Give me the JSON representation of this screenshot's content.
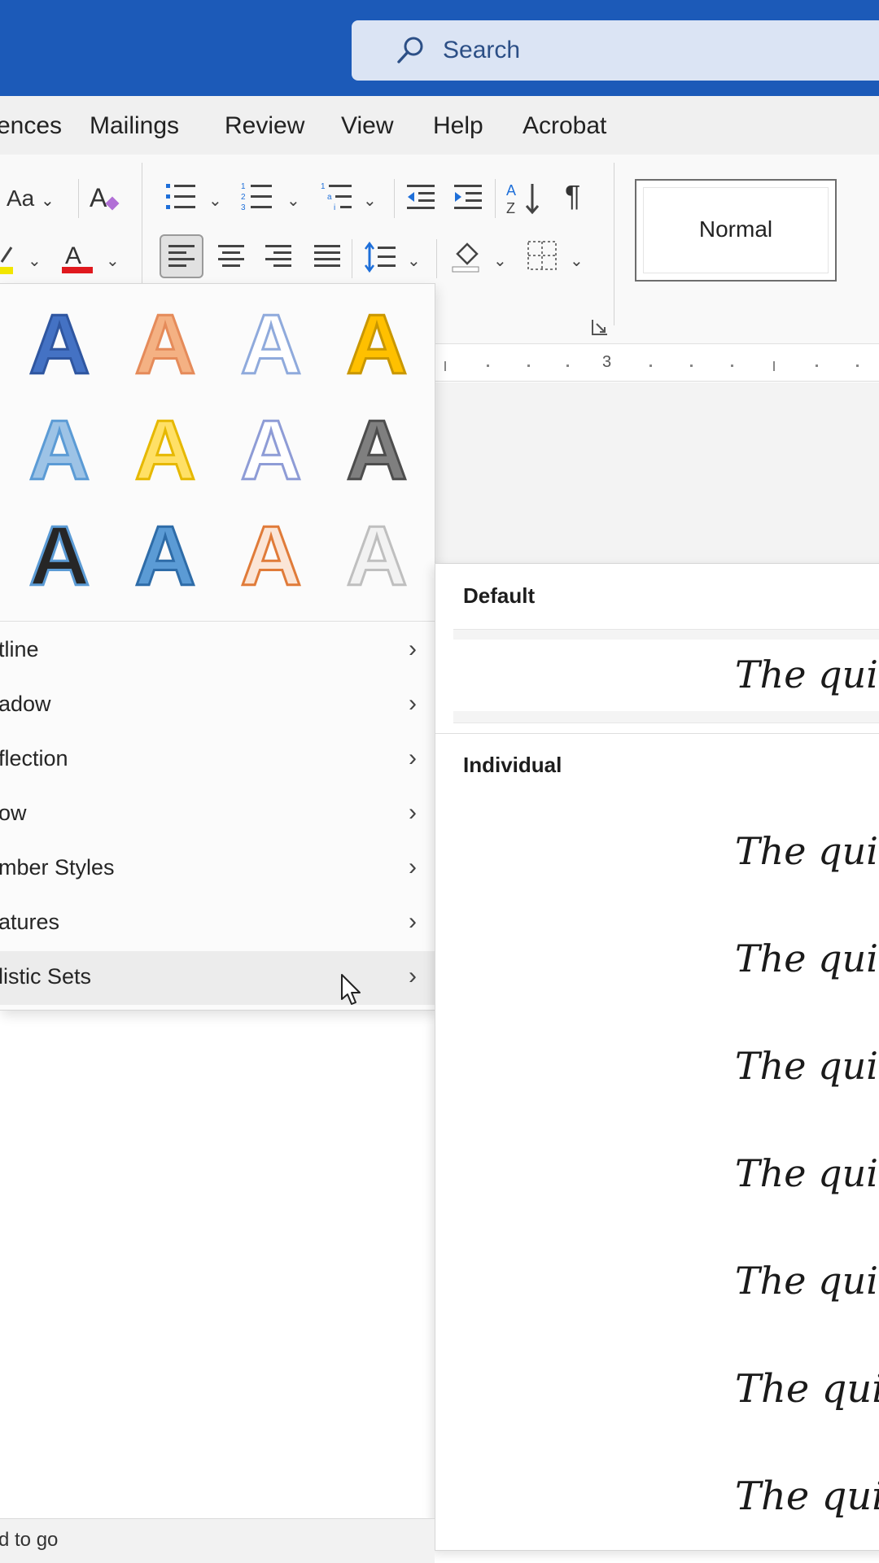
{
  "titlebar": {
    "search_placeholder": "Search",
    "search_icon": "search-icon"
  },
  "tabs": [
    "ences",
    "Mailings",
    "Review",
    "View",
    "Help",
    "Acrobat"
  ],
  "ribbon": {
    "change_case_label": "Aa",
    "styles": {
      "normal_label": "Normal"
    },
    "icons": [
      "change-case-icon",
      "clear-formatting-icon",
      "bullets-icon",
      "numbering-icon",
      "multilevel-list-icon",
      "decrease-indent-icon",
      "increase-indent-icon",
      "sort-icon",
      "show-formatting-icon",
      "highlight-icon",
      "font-color-icon",
      "align-left-icon",
      "align-center-icon",
      "align-right-icon",
      "justify-icon",
      "line-spacing-icon",
      "shading-icon",
      "borders-icon",
      "dialog-launcher-icon"
    ],
    "accent_colors": {
      "highlight": "#f2e600",
      "font_color": "#e0191e"
    }
  },
  "ruler": {
    "number": "3"
  },
  "text_effects": {
    "swatches": [
      {
        "label": "A",
        "fill": "#4472c4",
        "stroke": "#2f56a0"
      },
      {
        "label": "A",
        "fill": "#f4b183",
        "stroke": "#e58b5a"
      },
      {
        "label": "A",
        "fill": "#ffffff",
        "stroke": "#8faadc"
      },
      {
        "label": "A",
        "fill": "#ffc000",
        "stroke": "#c99700"
      },
      {
        "label": "A",
        "fill": "#9dc3e6",
        "stroke": "#5b9bd5"
      },
      {
        "label": "A",
        "fill": "#ffe066",
        "stroke": "#e6b800"
      },
      {
        "label": "A",
        "fill": "#ffffff",
        "stroke": "#8e9cd6"
      },
      {
        "label": "A",
        "fill": "#7f7f7f",
        "stroke": "#4d4d4d"
      },
      {
        "label": "A",
        "fill": "#262626",
        "stroke": "#5b9bd5"
      },
      {
        "label": "A",
        "fill": "#5b9bd5",
        "stroke": "#2e6ca8"
      },
      {
        "label": "A",
        "fill": "#fbe5d6",
        "stroke": "#e07b39"
      },
      {
        "label": "A",
        "fill": "#f2f2f2",
        "stroke": "#bfbfbf"
      }
    ],
    "menu": [
      {
        "label": "tline"
      },
      {
        "label": "adow"
      },
      {
        "label": "flection"
      },
      {
        "label": "ow"
      },
      {
        "label": "mber Styles"
      },
      {
        "label": "atures"
      },
      {
        "label": "listic Sets",
        "highlighted": true
      }
    ]
  },
  "stylistic_sets": {
    "default_header": "Default",
    "individual_header": "Individual",
    "default_sample": "The quick",
    "individual_samples": [
      "The quick",
      "The quick",
      "The quick",
      "The quick",
      "The quick",
      "The quick",
      "The quick"
    ]
  },
  "status": {
    "text": "d to go"
  }
}
